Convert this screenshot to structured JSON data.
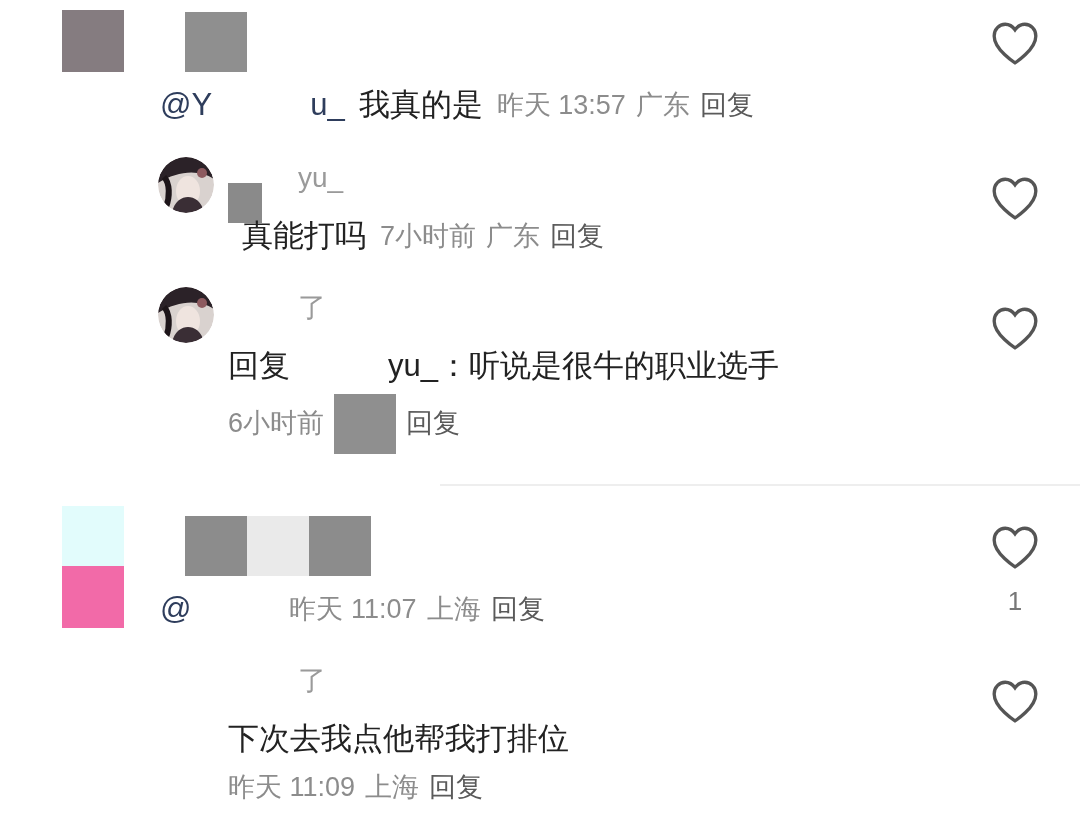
{
  "comments": [
    {
      "kind": "comment",
      "avatar": {
        "kind": "redacted"
      },
      "name": [
        {
          "kind": "redacted"
        }
      ],
      "body": [
        {
          "kind": "mention",
          "text": "@Y"
        },
        {
          "kind": "gap"
        },
        {
          "kind": "mention",
          "text": "u_"
        },
        {
          "kind": "text",
          "text": "我真的是"
        }
      ],
      "meta": [
        {
          "kind": "meta",
          "text": "昨天 13:57"
        },
        {
          "kind": "meta",
          "text": "广东"
        },
        {
          "kind": "reply",
          "text": "回复"
        }
      ],
      "inline_meta": true,
      "liked": false
    },
    {
      "kind": "reply",
      "avatar": {
        "kind": "picture"
      },
      "name": [
        {
          "kind": "gap"
        },
        {
          "kind": "name",
          "text": "yu_"
        }
      ],
      "body": [
        {
          "kind": "redacted-small"
        },
        {
          "kind": "text",
          "text": "真能打吗"
        }
      ],
      "meta": [
        {
          "kind": "meta",
          "text": "7小时前"
        },
        {
          "kind": "meta",
          "text": "广东"
        },
        {
          "kind": "reply",
          "text": "回复"
        }
      ],
      "inline_meta": true,
      "liked": false
    },
    {
      "kind": "reply",
      "avatar": {
        "kind": "picture"
      },
      "name": [
        {
          "kind": "gap"
        },
        {
          "kind": "name",
          "text": "了"
        }
      ],
      "body": [
        {
          "kind": "text",
          "text": "回复"
        },
        {
          "kind": "gap"
        },
        {
          "kind": "text",
          "text": "yu_：听说是很牛的职业选手"
        }
      ],
      "meta": [
        {
          "kind": "meta",
          "text": "6小时前"
        },
        {
          "kind": "redacted"
        },
        {
          "kind": "reply",
          "text": "回复"
        }
      ],
      "inline_meta": false,
      "liked": false
    },
    {
      "kind": "comment",
      "avatar": {
        "kind": "redacted-split"
      },
      "name": [
        {
          "kind": "redacted-triple"
        }
      ],
      "body": [
        {
          "kind": "mention",
          "text": "@"
        },
        {
          "kind": "gap"
        }
      ],
      "meta": [
        {
          "kind": "meta",
          "text": "昨天 11:07"
        },
        {
          "kind": "meta",
          "text": "上海"
        },
        {
          "kind": "reply",
          "text": "回复"
        }
      ],
      "inline_meta": true,
      "liked": false,
      "likes": "1"
    },
    {
      "kind": "reply",
      "name": [
        {
          "kind": "gap"
        },
        {
          "kind": "name",
          "text": "了"
        }
      ],
      "body": [
        {
          "kind": "text",
          "text": "下次去我点他帮我打排位"
        }
      ],
      "meta": [
        {
          "kind": "meta",
          "text": "昨天 11:09"
        },
        {
          "kind": "meta",
          "text": "上海"
        },
        {
          "kind": "reply",
          "text": "回复"
        }
      ],
      "inline_meta": false,
      "liked": false
    }
  ]
}
